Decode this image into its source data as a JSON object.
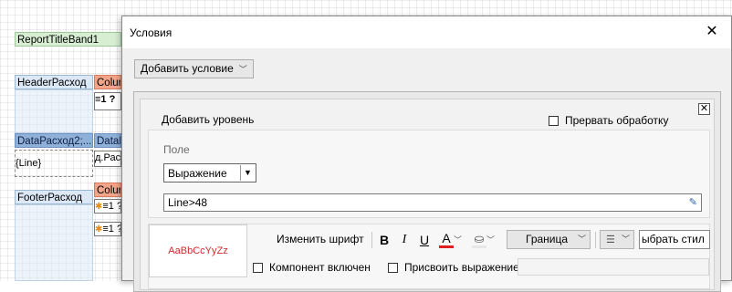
{
  "designer": {
    "report_title_band": "ReportTitleBand1",
    "header_band": "HeaderРасход",
    "header_col": "Colur",
    "header_cell": "≡1 ?",
    "data_band": "DataРасход2;...",
    "data_col": "DataP",
    "line_cell": "{Line}",
    "data_cell": "д.Рас",
    "footer_band": "FooterРасход",
    "footer_col": "Colur",
    "footer_cell_1": "≡1 ?",
    "footer_cell_2": "≡1 ?"
  },
  "dialog": {
    "title": "Условия",
    "close_symbol": "✕",
    "add_condition_label": "Добавить условие",
    "condition": {
      "add_level_label": "Добавить уровень",
      "break_processing_label": "Прервать обработку",
      "close_symbol": "✕",
      "field_label": "Поле",
      "field_type_value": "Выражение",
      "expression_value": "Line>48",
      "format": {
        "preview_text": "AaBbCcYyZz",
        "change_font_label": "Изменить шрифт",
        "bold_label": "B",
        "italic_label": "I",
        "underline_label": "U",
        "font_color_glyph": "A",
        "border_label": "Граница",
        "style_select_value": "ыбрать стил",
        "component_enabled_label": "Компонент включен",
        "assign_expression_label": "Присвоить выражение"
      }
    }
  },
  "colors": {
    "green_band": "#d7eed3",
    "blue_band": "#dde8f6",
    "dark_blue_band": "#8fb0d9",
    "orange_column": "#f3a58a",
    "preview_text": "#d32b2b",
    "font_color_bar": "#e02020"
  }
}
